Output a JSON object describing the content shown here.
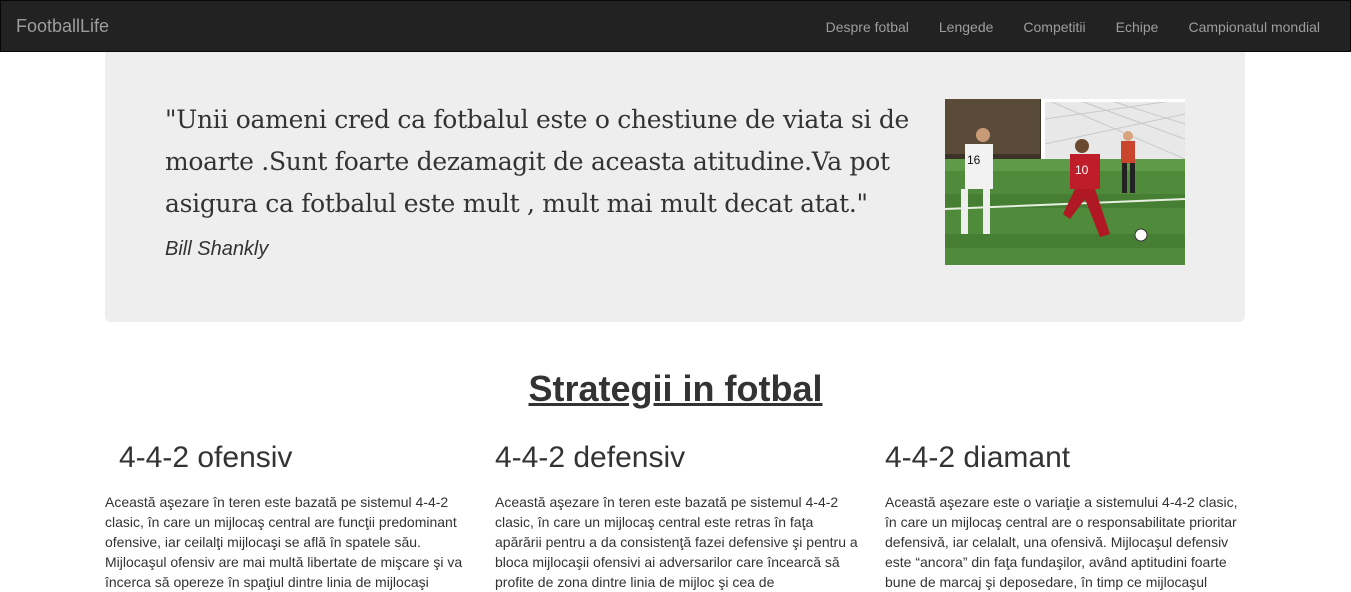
{
  "navbar": {
    "brand": "FootballLife",
    "links": [
      "Despre fotbal",
      "Lengede",
      "Competitii",
      "Echipe",
      "Campionatul mondial"
    ]
  },
  "jumbotron": {
    "quote": "\"Unii oameni cred ca fotbalul este o chestiune de viata si de moarte .Sunt foarte dezamagit de aceasta atitudine.Va pot asigura ca fotbalul este mult , mult mai mult decat atat.\"",
    "author": "Bill Shankly"
  },
  "section": {
    "title": "Strategii in fotbal"
  },
  "strategies": [
    {
      "title": "4-4-2 ofensiv",
      "text": "Această aşezare în teren este bazată pe sistemul 4-4-2 clasic, în care un mijlocaş central are funcţii predominant ofensive, iar ceilalţi mijlocaşi se află în spatele său. Mijlocaşul ofensiv are mai multă libertate de mişcare şi va încerca să opereze în spaţiul dintre linia de mijlocaşi"
    },
    {
      "title": "4-4-2 defensiv",
      "text": "Această aşezare în teren este bazată pe sistemul 4-4-2 clasic, în care un mijlocaş central este retras în faţa apărării pentru a da consistenţă fazei defensive şi pentru a bloca mijlocaşii ofensivi ai adversarilor care încearcă să profite de zona dintre linia de mijloc şi cea de"
    },
    {
      "title": "4-4-2 diamant",
      "text": "Această aşezare este o variaţie a sistemului 4-4-2 clasic, în care un mijlocaş central are o responsabilitate prioritar defensivă, iar celalalt, una ofensivă. Mijlocaşul defensiv este “ancora” din faţa fundaşilor, având aptitudini foarte bune de marcaj şi deposedare, în timp ce mijlocaşul"
    }
  ]
}
